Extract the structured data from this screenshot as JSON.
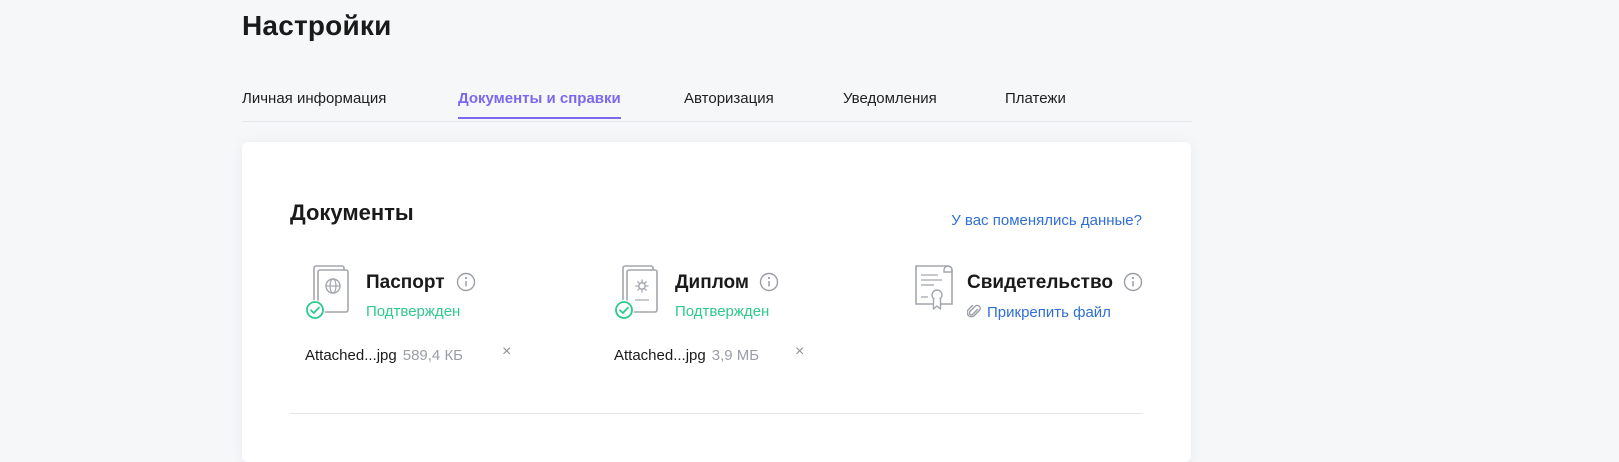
{
  "page": {
    "title": "Настройки"
  },
  "tabs": [
    {
      "label": "Личная информация",
      "active": false
    },
    {
      "label": "Документы и справки",
      "active": true
    },
    {
      "label": "Авторизация",
      "active": false
    },
    {
      "label": "Уведомления",
      "active": false
    },
    {
      "label": "Платежи",
      "active": false
    }
  ],
  "documents": {
    "title": "Документы",
    "changed_link": "У вас поменялись данные?",
    "items": [
      {
        "name": "Паспорт",
        "status": "Подтвержден",
        "icon": "passport-icon",
        "file": {
          "name": "Attached...jpg",
          "size": "589,4 КБ"
        }
      },
      {
        "name": "Диплом",
        "status": "Подтвержден",
        "icon": "diploma-icon",
        "file": {
          "name": "Attached...jpg",
          "size": "3,9 МБ"
        }
      },
      {
        "name": "Свидетельство",
        "attach_label": "Прикрепить файл",
        "icon": "certificate-icon"
      }
    ]
  },
  "colors": {
    "accent": "#7b68ee",
    "link": "#2f6fd6",
    "success": "#2ec98d",
    "muted": "#9b9ea5",
    "background": "#f6f7f9"
  }
}
